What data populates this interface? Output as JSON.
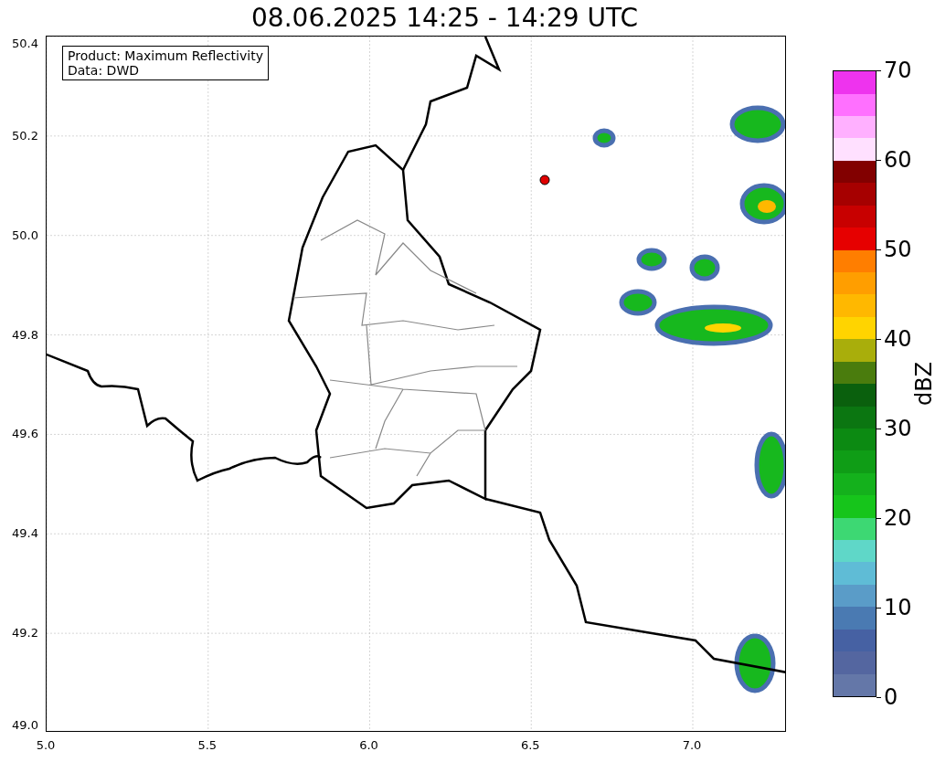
{
  "title": "08.06.2025 14:25 - 14:29 UTC",
  "legend": {
    "lines": [
      "Product: Maximum Reflectivity",
      "Data: DWD"
    ]
  },
  "x_axis": {
    "ticks": [
      "5.0",
      "5.5",
      "6.0",
      "6.5",
      "7.0"
    ]
  },
  "y_axis": {
    "ticks": [
      "50.4",
      "50.2",
      "50.0",
      "49.8",
      "49.6",
      "49.4",
      "49.2",
      "49.0"
    ]
  },
  "colorbar": {
    "label": "dBZ",
    "ticks": [
      "70",
      "60",
      "50",
      "40",
      "30",
      "20",
      "10",
      "0"
    ],
    "bands": [
      {
        "color": "#6477a8"
      },
      {
        "color": "#5466a0"
      },
      {
        "color": "#4661a3"
      },
      {
        "color": "#4a7ab2"
      },
      {
        "color": "#5a9cc8"
      },
      {
        "color": "#5fbcd6"
      },
      {
        "color": "#5fd7c8"
      },
      {
        "color": "#3dd873"
      },
      {
        "color": "#16c51b"
      },
      {
        "color": "#14b11c"
      },
      {
        "color": "#0f9d16"
      },
      {
        "color": "#0c8a12"
      },
      {
        "color": "#0b7611"
      },
      {
        "color": "#0a600d"
      },
      {
        "color": "#4a7c0d"
      },
      {
        "color": "#a9ae0b"
      },
      {
        "color": "#ffd400"
      },
      {
        "color": "#ffb800"
      },
      {
        "color": "#ff9e00"
      },
      {
        "color": "#ff7e00"
      },
      {
        "color": "#e60000"
      },
      {
        "color": "#c80000"
      },
      {
        "color": "#a60000"
      },
      {
        "color": "#820000"
      },
      {
        "color": "#ffe0ff"
      },
      {
        "color": "#ffb0ff"
      },
      {
        "color": "#ff70ff"
      },
      {
        "color": "#ee33ee"
      }
    ]
  }
}
